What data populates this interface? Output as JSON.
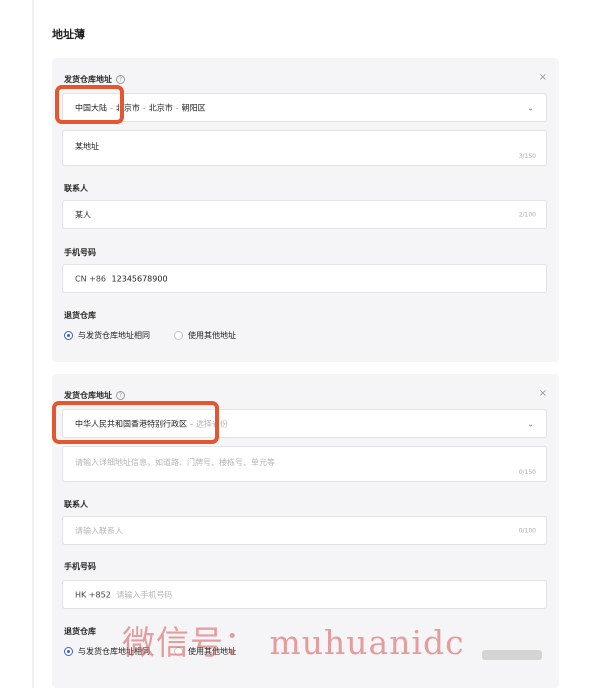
{
  "page_title": "地址薄",
  "help_glyph": "?",
  "close_glyph": "×",
  "chevron_glyph": "⌄",
  "address_sep": "-",
  "cards": [
    {
      "warehouse_label": "发货仓库地址",
      "region_country": "中国大陆",
      "region_city": "北京市",
      "region_city2": "北京市",
      "region_district": "朝阳区",
      "address_value": "某地址",
      "address_counter": "3/150",
      "contact_label": "联系人",
      "contact_value": "某人",
      "contact_counter": "2/100",
      "phone_label": "手机号码",
      "phone_prefix": "CN +86",
      "phone_value": "12345678900",
      "return_label": "退货仓库",
      "return_opt_same": "与发货仓库地址相同",
      "return_opt_other": "使用其他地址"
    },
    {
      "warehouse_label": "发货仓库地址",
      "region_country": "中华人民共和国香港特别行政区",
      "region_placeholder": "选择省份",
      "address_placeholder": "请输入详细地址信息，如道路、门牌号、楼栋号、单元等",
      "address_counter": "0/150",
      "contact_label": "联系人",
      "contact_placeholder": "请输入联系人",
      "contact_counter": "0/100",
      "phone_label": "手机号码",
      "phone_prefix": "HK +852",
      "phone_placeholder": "请输入手机号码",
      "return_label": "退货仓库",
      "return_opt_same": "与发货仓库地址相同",
      "return_opt_other": "使用其他地址"
    }
  ],
  "watermark": "微信号： muhuanidc",
  "colors": {
    "accent": "#3b5bdb",
    "highlight": "#e2572f",
    "card_bg": "#f5f5f7"
  }
}
